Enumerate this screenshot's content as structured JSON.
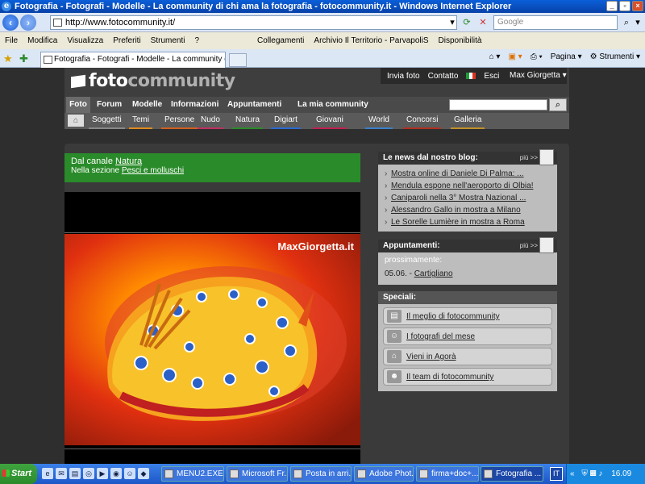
{
  "window": {
    "title": "Fotografia - Fotografi - Modelle - La community di chi ama la fotografia - fotocommunity.it - Windows Internet Explorer",
    "icon": "ie-icon"
  },
  "addressbar": {
    "url": "http://www.fotocommunity.it/",
    "search_placeholder": "Google"
  },
  "menu": {
    "items": [
      "File",
      "Modifica",
      "Visualizza",
      "Preferiti",
      "Strumenti",
      "?"
    ],
    "links_label": "Collegamenti",
    "bookmarks": [
      "Archivio Il Territorio - ParvapoliS",
      "Disponibilità"
    ]
  },
  "tabs": {
    "active_tab": "Fotografia - Fotografi - Modelle - La community di chi ...",
    "tools": [
      "Pagina",
      "Strumenti"
    ]
  },
  "site": {
    "logo_a": "foto",
    "logo_b": "community",
    "header_links": [
      "Invia foto",
      "Contatto",
      "Esci"
    ],
    "user": "Max Giorgetta",
    "main_nav": [
      "Foto",
      "Forum",
      "Modelle",
      "Informazioni",
      "Appuntamenti",
      "La mia community"
    ],
    "sub_nav": [
      {
        "label": "Soggetti",
        "color": "#888888"
      },
      {
        "label": "Temi",
        "color": "#e08a1e"
      },
      {
        "label": "Persone",
        "color": "#d06020"
      },
      {
        "label": "Nudo",
        "color": "#c03060"
      },
      {
        "label": "Natura",
        "color": "#2a8b2a"
      },
      {
        "label": "Digiart",
        "color": "#2a6ad0"
      },
      {
        "label": "Giovani",
        "color": "#c02050"
      },
      {
        "label": "World",
        "color": "#3a80c8"
      },
      {
        "label": "Concorsi",
        "color": "#b03020"
      },
      {
        "label": "Galleria",
        "color": "#c0902a"
      }
    ]
  },
  "feature": {
    "channel_prefix": "Dal canale ",
    "channel": "Natura",
    "section_prefix": "Nella sezione ",
    "section": "Pesci e molluschi",
    "watermark": "MaxGiorgetta.it",
    "accent": "#2a8b2a"
  },
  "news": {
    "title": "Le news dal nostro blog:",
    "more": "più >>",
    "items": [
      "Mostra online di Daniele Di Palma: ...",
      "Mendula espone nell'aeroporto di Olbia!",
      "Caniparoli nella 3° Mostra Nazional ...",
      "Alessandro Gallo in mostra a Milano",
      "Le Sorelle Lumière in mostra a Roma"
    ]
  },
  "appointments": {
    "title": "Appuntamenti:",
    "more": "più >>",
    "label": "prossimamente:",
    "date": "05.06. - ",
    "place": "Cartigliano"
  },
  "special": {
    "title": "Speciali:",
    "items": [
      "Il meglio di fotocommunity",
      "I fotografi del mese",
      "Vieni in Agorà",
      "Il team di fotocommunity"
    ]
  },
  "taskbar": {
    "start": "Start",
    "tasks": [
      "MENU2.EXE",
      "Microsoft Fr...",
      "Posta in arri...",
      "Adobe Phot...",
      "firma+doc+...",
      "Fotografia ..."
    ],
    "lang": "IT",
    "clock": "16.09"
  }
}
